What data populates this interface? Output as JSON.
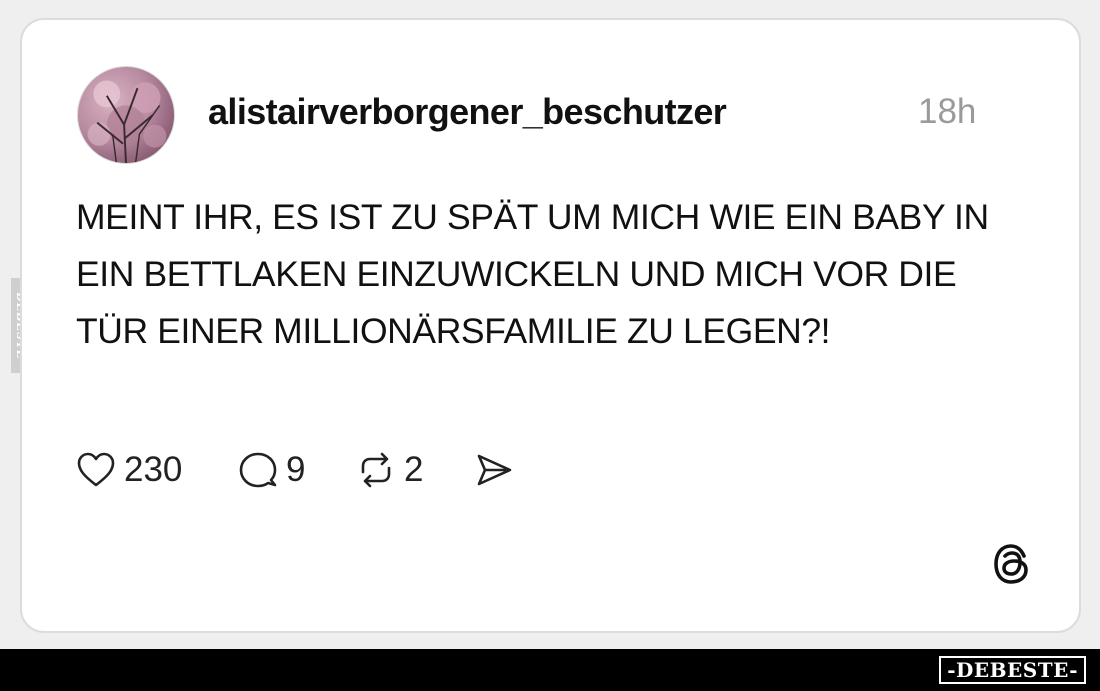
{
  "post": {
    "username": "alistairverborgener_beschutzer",
    "timestamp": "18h",
    "text": "MEINT IHR, ES IST ZU SPÄT UM MICH WIE EIN BABY IN EIN BETTLAKEN EINZUWICKELN UND MICH VOR DIE TÜR EINER MILLIONÄRSFAMILIE ZU LEGEN?!",
    "avatar_icon": "cherry-blossom-tree-photo"
  },
  "actions": {
    "likes": "230",
    "replies": "9",
    "reposts": "2",
    "like_icon": "heart-icon",
    "reply_icon": "speech-bubble-icon",
    "repost_icon": "repost-arrows-icon",
    "share_icon": "send-icon"
  },
  "branding": {
    "app_logo": "threads-logo-icon",
    "side_watermark": "DEBESTE",
    "bottom_watermark": "-DEBESTE-"
  },
  "colors": {
    "background": "#efefef",
    "card": "#ffffff",
    "text": "#111111",
    "muted": "#9a9a9a",
    "bar": "#000000"
  }
}
